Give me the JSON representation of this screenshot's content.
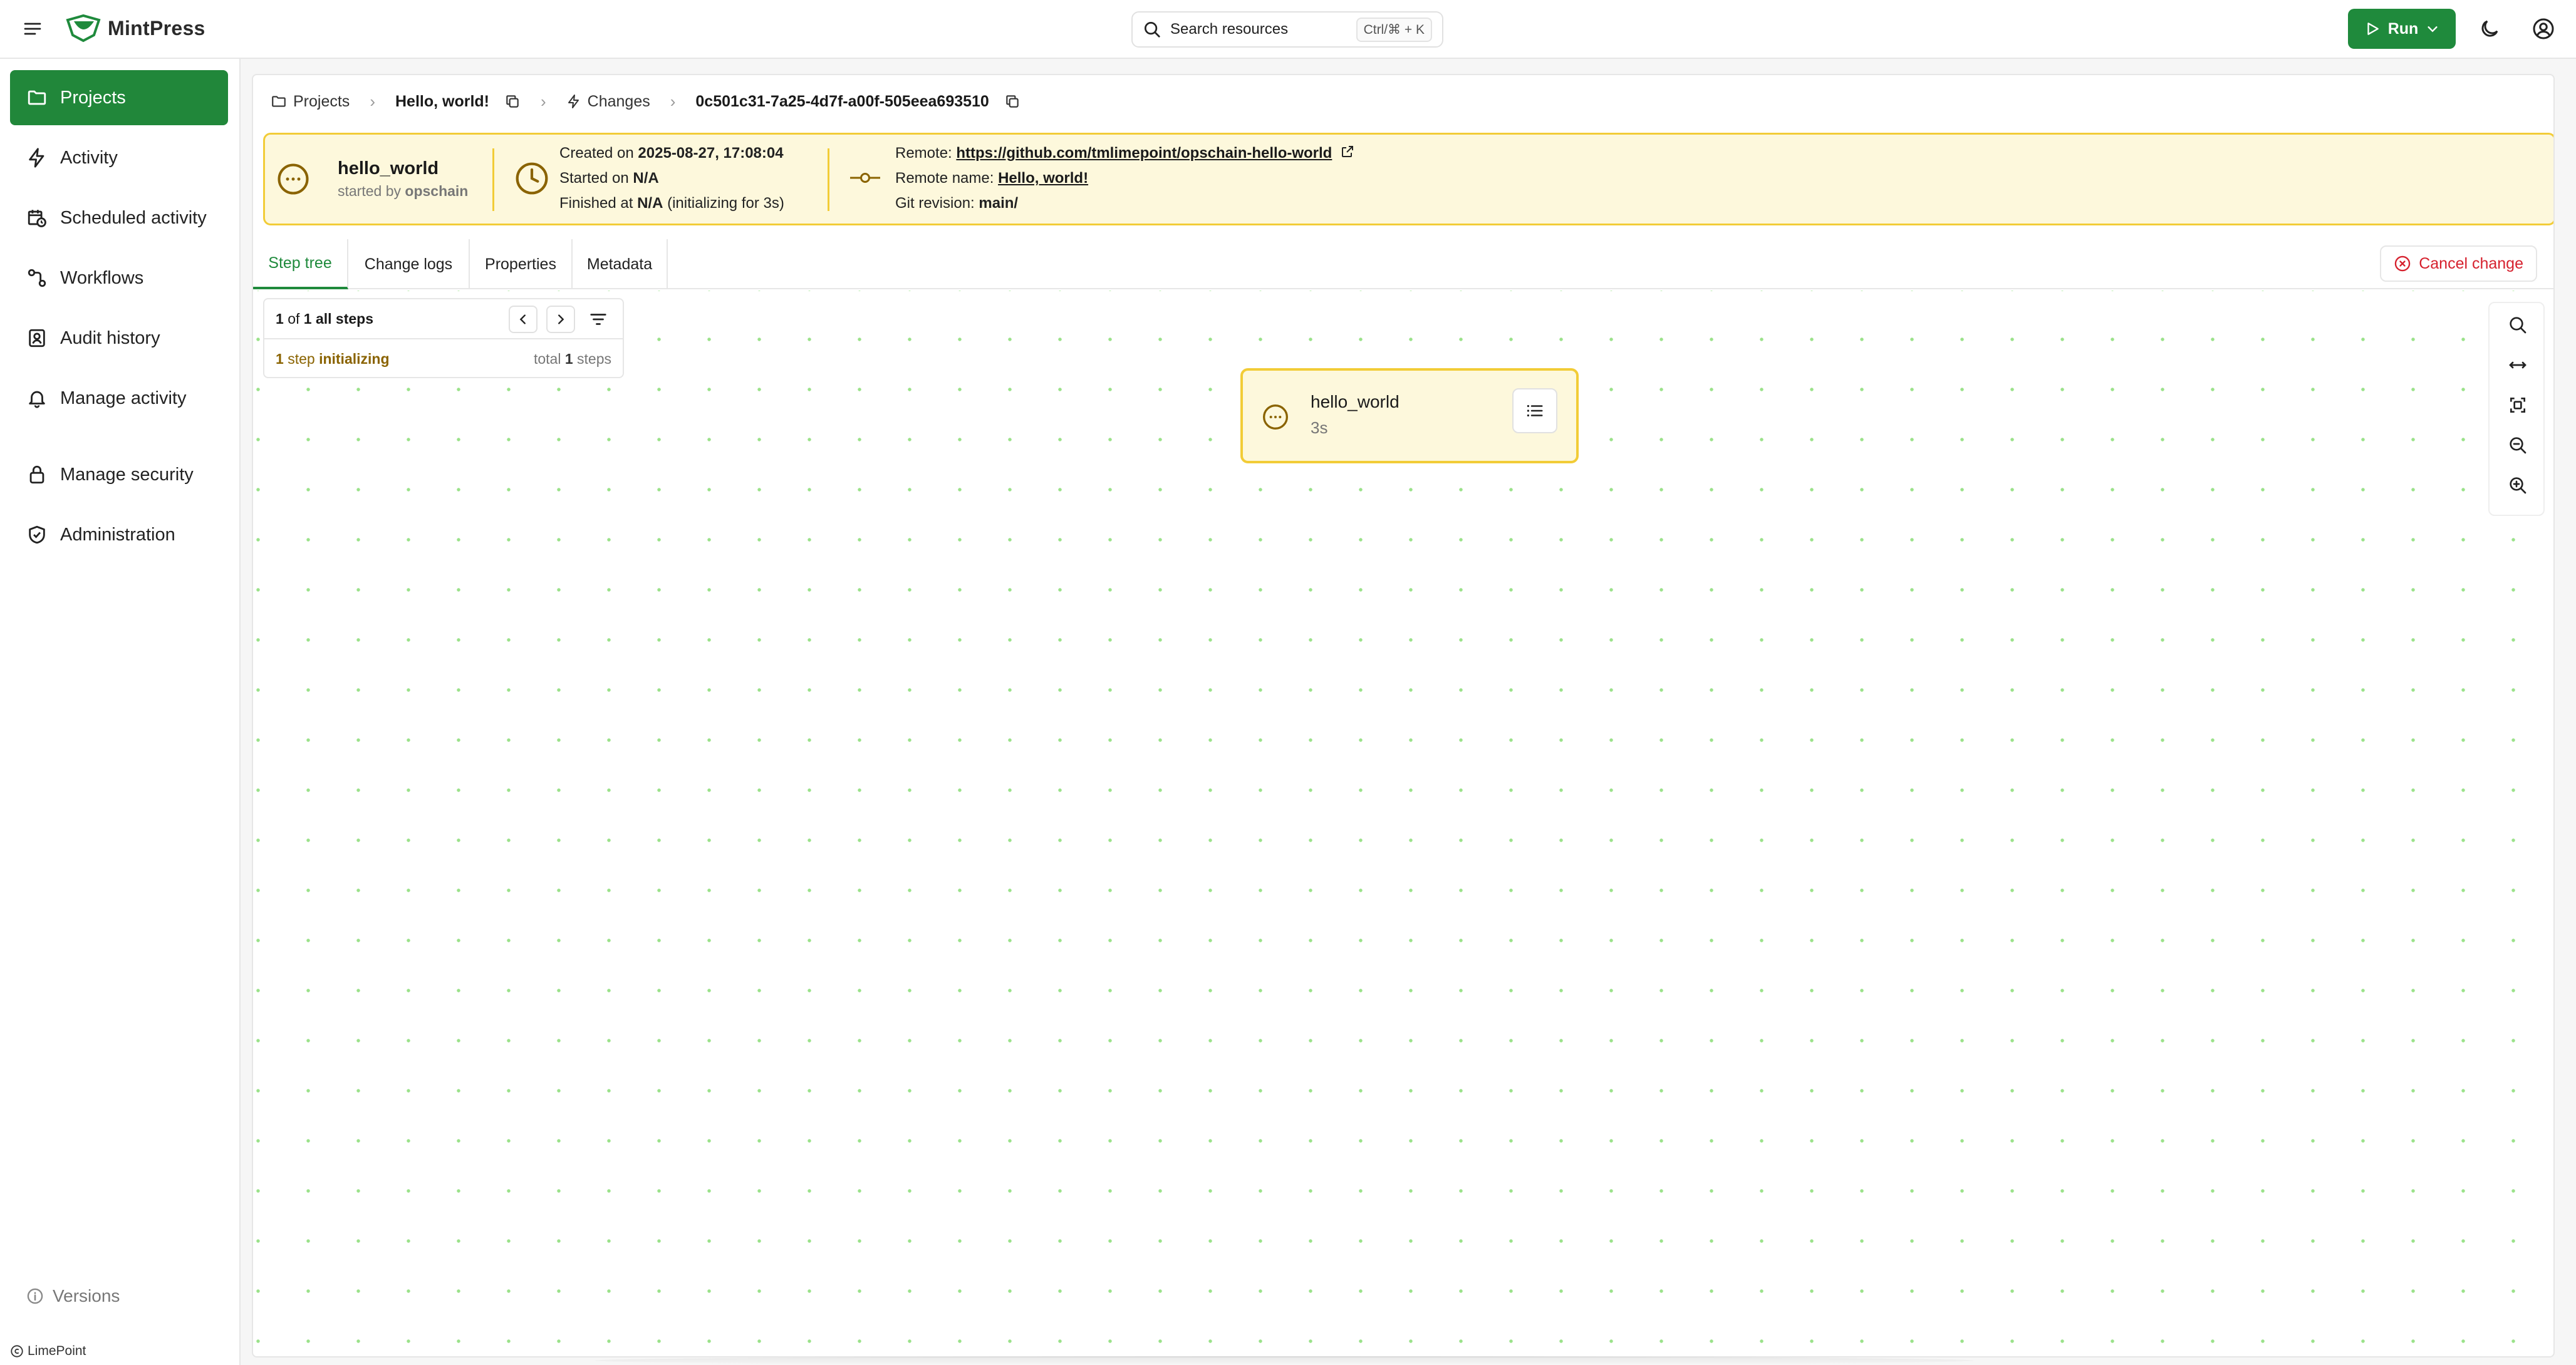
{
  "app": {
    "name": "MintPress"
  },
  "search": {
    "label": "Search resources",
    "shortcut": "Ctrl/⌘ + K"
  },
  "header": {
    "run_label": "Run"
  },
  "sidebar": {
    "items": [
      {
        "label": "Projects",
        "icon": "folder-icon",
        "active": true
      },
      {
        "label": "Activity",
        "icon": "bolt-icon"
      },
      {
        "label": "Scheduled activity",
        "icon": "calendar-clock-icon"
      },
      {
        "label": "Workflows",
        "icon": "workflow-icon"
      },
      {
        "label": "Audit history",
        "icon": "audit-icon"
      },
      {
        "label": "Manage activity",
        "icon": "bell-icon"
      },
      {
        "label": "Manage security",
        "icon": "lock-icon"
      },
      {
        "label": "Administration",
        "icon": "shield-check-icon"
      }
    ],
    "versions_label": "Versions",
    "footer": "LimePoint"
  },
  "breadcrumb": {
    "projects": "Projects",
    "project": "Hello, world!",
    "changes": "Changes",
    "change_id": "0c501c31-7a25-4d7f-a00f-505eea693510"
  },
  "banner": {
    "name": "hello_world",
    "started_by_label": "started by",
    "started_by": "opschain",
    "created_label": "Created on",
    "created_value": "2025-08-27, 17:08:04",
    "started_label": "Started on",
    "started_value": "N/A",
    "finished_label": "Finished at",
    "finished_value": "N/A",
    "finished_note": "(initializing for 3s)",
    "remote_label": "Remote:",
    "remote_url": "https://github.com/tmlimepoint/opschain-hello-world",
    "remote_name_label": "Remote name:",
    "remote_name": "Hello, world!",
    "git_revision_label": "Git revision:",
    "git_revision": "main/"
  },
  "tabs": [
    "Step tree",
    "Change logs",
    "Properties",
    "Metadata"
  ],
  "cancel_label": "Cancel change",
  "steps": {
    "current": "1",
    "of_label": "of",
    "total": "1",
    "suffix": "all steps",
    "status_count": "1",
    "status_unit": "step",
    "status_state": "initializing",
    "total_label": "total",
    "total_count": "1",
    "total_unit": "steps"
  },
  "node": {
    "name": "hello_world",
    "duration": "3s"
  },
  "colors": {
    "accent": "#1f8a3c",
    "warning_bg": "#fdf8dc",
    "warning_border": "#f2cc37",
    "danger": "#d6212e"
  }
}
